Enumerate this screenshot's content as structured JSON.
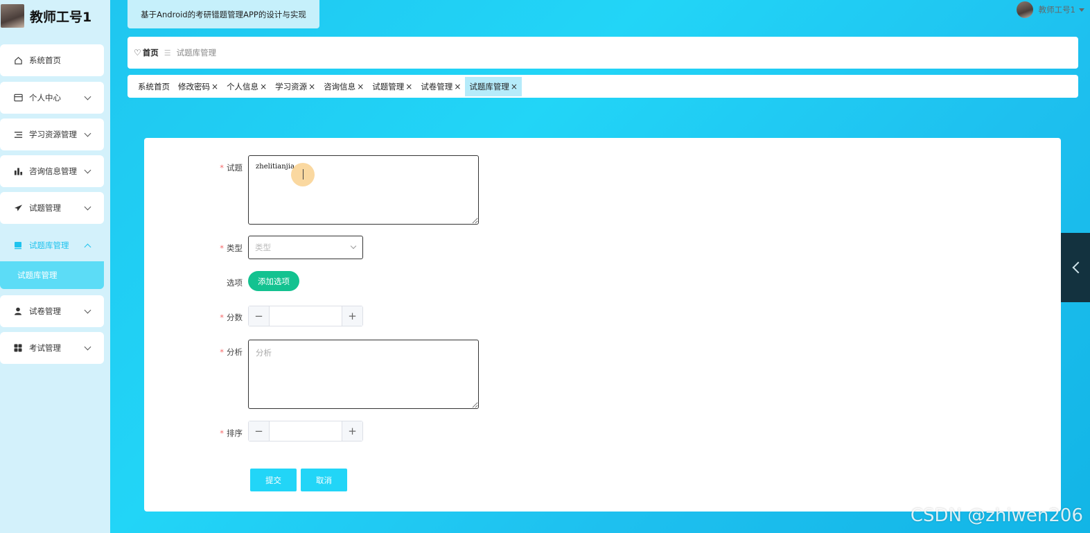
{
  "sidebar": {
    "brand": "教师工号1",
    "items": [
      {
        "label": "系统首页",
        "icon": "home-icon"
      },
      {
        "label": "个人中心",
        "icon": "id-card-icon"
      },
      {
        "label": "学习资源管理",
        "icon": "list-icon"
      },
      {
        "label": "咨询信息管理",
        "icon": "bar-chart-icon"
      },
      {
        "label": "试题管理",
        "icon": "paper-plane-icon"
      },
      {
        "label": "试题库管理",
        "icon": "book-icon"
      },
      {
        "label": "试卷管理",
        "icon": "user-icon"
      },
      {
        "label": "考试管理",
        "icon": "grid-icon"
      }
    ],
    "submenu_label": "试题库管理"
  },
  "header": {
    "app_title": "基于Android的考研错题管理APP的设计与实现",
    "username": "教师工号1"
  },
  "breadcrumb": {
    "home": "首页",
    "separator": "☰",
    "current": "试题库管理"
  },
  "tabs": [
    {
      "label": "系统首页",
      "closable": false
    },
    {
      "label": "修改密码",
      "closable": true
    },
    {
      "label": "个人信息",
      "closable": true
    },
    {
      "label": "学习资源",
      "closable": true
    },
    {
      "label": "咨询信息",
      "closable": true
    },
    {
      "label": "试题管理",
      "closable": true
    },
    {
      "label": "试卷管理",
      "closable": true
    },
    {
      "label": "试题库管理",
      "closable": true,
      "active": true
    }
  ],
  "tab_close_glyph": "×",
  "form": {
    "question_label": "试题",
    "question_value": "zhelitianjia",
    "type_label": "类型",
    "type_placeholder": "类型",
    "options_label": "选项",
    "add_option_label": "添加选项",
    "score_label": "分数",
    "analysis_label": "分析",
    "analysis_placeholder": "分析",
    "order_label": "排序",
    "submit_label": "提交",
    "cancel_label": "取消",
    "required_mark": "*"
  },
  "watermark": "CSDN @zhiwen206",
  "colors": {
    "accent": "#22d5f7",
    "add_button": "#13c290",
    "required": "#f56c6c"
  }
}
